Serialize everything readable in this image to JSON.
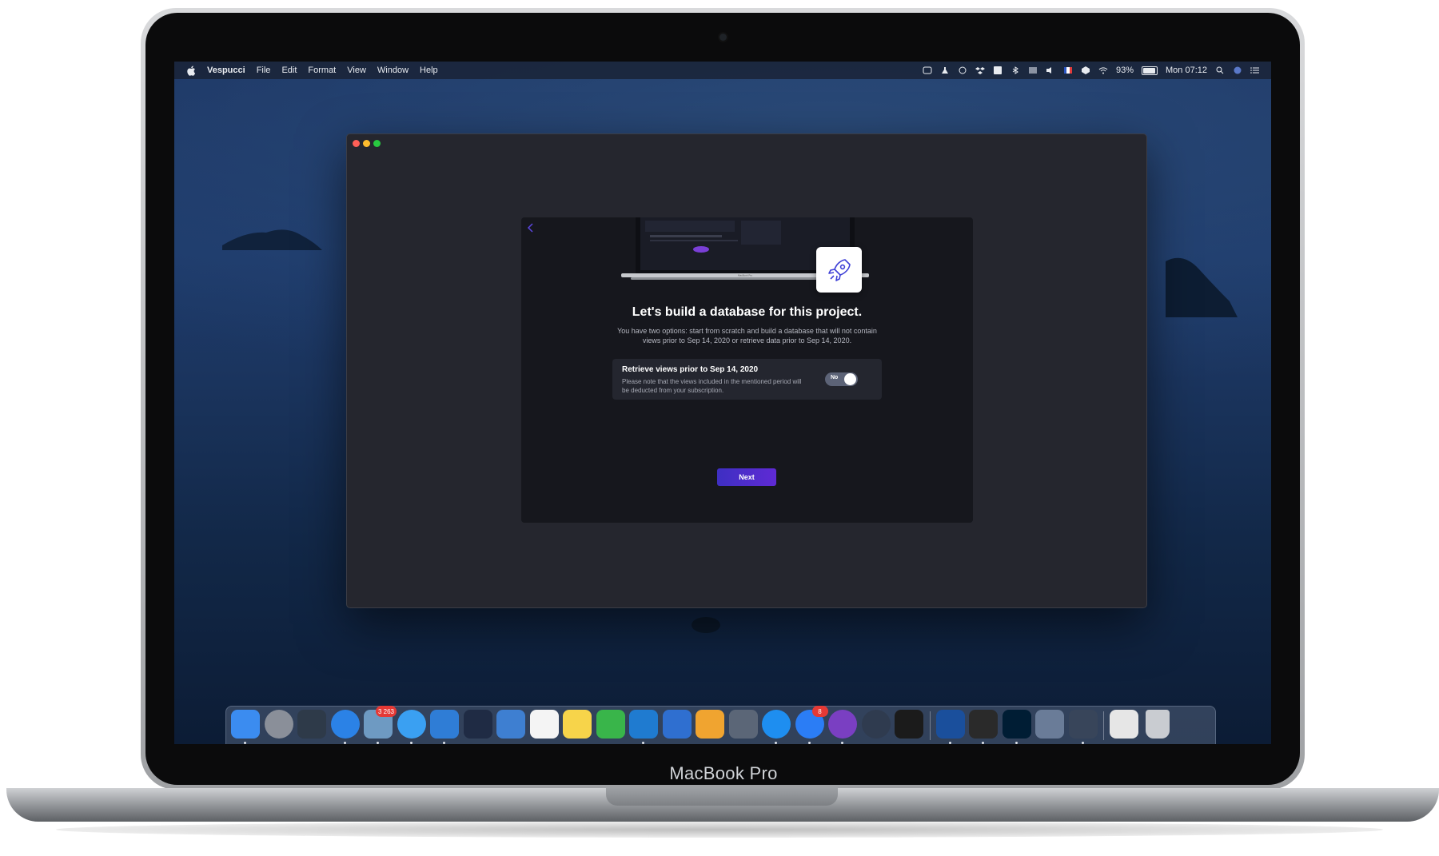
{
  "device": {
    "label": "MacBook Pro"
  },
  "menubar": {
    "app_name": "Vespucci",
    "items": [
      "File",
      "Edit",
      "Format",
      "View",
      "Window",
      "Help"
    ],
    "battery_percent": "93%",
    "battery_level": 0.93,
    "clock": "Mon 07:12"
  },
  "dialog": {
    "title": "Let's build a database for this project.",
    "description": "You have two options: start from scratch and build a database that will not contain views prior to Sep 14, 2020 or retrieve data prior to Sep 14, 2020.",
    "option": {
      "title": "Retrieve views prior to Sep 14, 2020",
      "note": "Please note that the views included in the mentioned period will be deducted from your subscription.",
      "toggle_label": "No"
    },
    "next_label": "Next",
    "hero_label": "MacBook Pro"
  },
  "dock": {
    "apps": [
      {
        "icon": "finder-icon",
        "color": "#3b8cf0"
      },
      {
        "icon": "launchpad-icon",
        "color": "#8a8f99"
      },
      {
        "icon": "mission-control-icon",
        "color": "#2e3a49"
      },
      {
        "icon": "safari-icon",
        "color": "#2b82e6"
      },
      {
        "icon": "preview-icon",
        "color": "#6e9ac2",
        "badge": "3 263"
      },
      {
        "icon": "messages-icon",
        "color": "#3aa0f2"
      },
      {
        "icon": "xcode-icon",
        "color": "#2f7dd6"
      },
      {
        "icon": "instruments-icon",
        "color": "#1f2b44"
      },
      {
        "icon": "sketch-blueprint-icon",
        "color": "#3e7fd1"
      },
      {
        "icon": "calendar-icon",
        "color": "#f4f4f4"
      },
      {
        "icon": "notes-icon",
        "color": "#f7d44a"
      },
      {
        "icon": "numbers-icon",
        "color": "#39b54a"
      },
      {
        "icon": "vscode-icon",
        "color": "#1f7bd0"
      },
      {
        "icon": "keynote-icon",
        "color": "#2f6fd0"
      },
      {
        "icon": "pages-icon",
        "color": "#f0a430"
      },
      {
        "icon": "script-editor-icon",
        "color": "#5b6677"
      },
      {
        "icon": "app-store-icon",
        "color": "#1e8ef0"
      },
      {
        "icon": "messenger-icon",
        "color": "#2b7df5",
        "badge": "8"
      },
      {
        "icon": "github-desktop-icon",
        "color": "#7a3fc2"
      },
      {
        "icon": "quicktime-icon",
        "color": "#2f3b4f"
      },
      {
        "icon": "terminal-icon",
        "color": "#1b1b1b"
      },
      {
        "icon": "affinity-designer-icon",
        "color": "#1a4f9c"
      },
      {
        "icon": "datagrip-icon",
        "color": "#2a2a2a"
      },
      {
        "icon": "photoshop-icon",
        "color": "#001d34"
      },
      {
        "icon": "image-capture-icon",
        "color": "#6a7c98"
      },
      {
        "icon": "dashboard-icon",
        "color": "#38455a"
      },
      {
        "icon": "calculator-icon",
        "color": "#e6e6e6"
      },
      {
        "icon": "trash-icon",
        "color": "#c9ccd1"
      }
    ]
  }
}
